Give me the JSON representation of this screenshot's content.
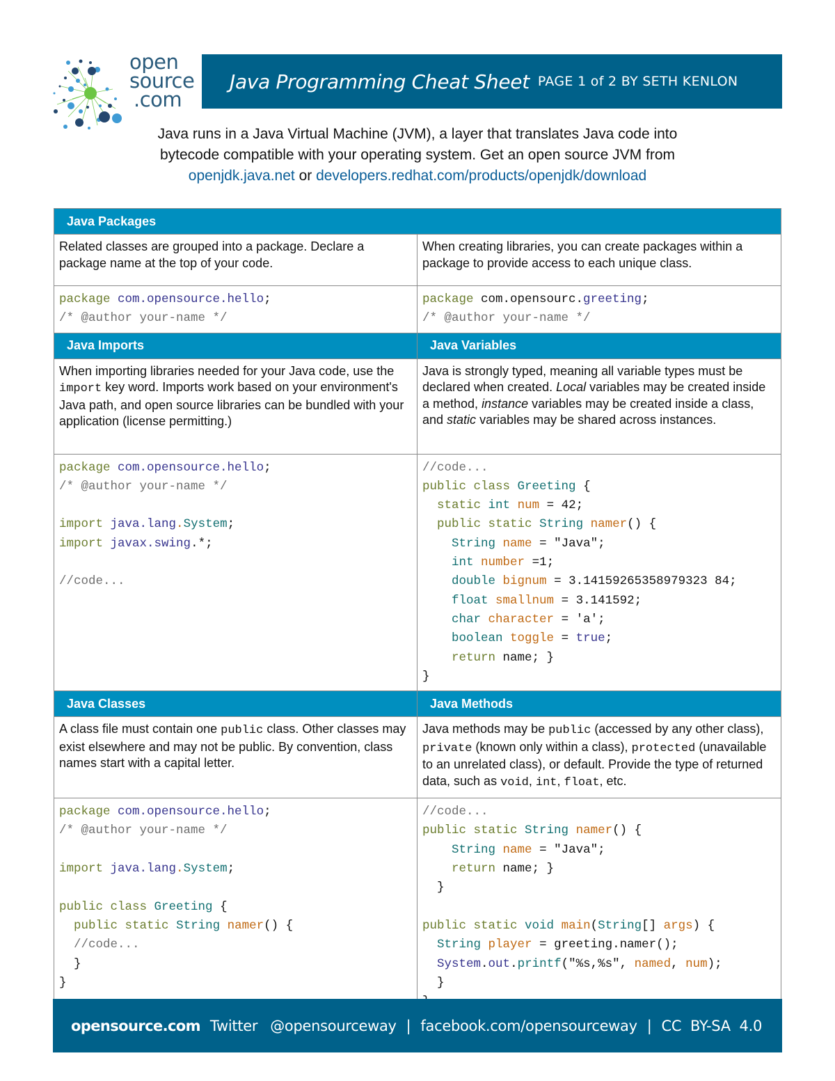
{
  "logo": {
    "line1": "open",
    "line2": "source",
    "line3": ".com",
    "colors": {
      "dark_blue": "#2a5b7c",
      "light_blue": "#3f9bd5",
      "green": "#6cc644"
    }
  },
  "header": {
    "title": "Java Programming Cheat Sheet",
    "subtitle": "PAGE 1 of 2 BY SETH KENLON",
    "bg_color": "#00618a"
  },
  "intro": {
    "line1": "Java runs in a Java Virtual Machine (JVM), a layer that translates Java code into",
    "line2": "bytecode compatible with your operating system. Get an open source JVM from",
    "link1": "openjdk.java.net",
    "or": " or ",
    "link2": "developers.redhat.com/products/openjdk/download"
  },
  "sections": {
    "packages": {
      "title": "Java Packages",
      "left_desc": "Related classes are grouped into a package. Declare a package name at the top of your code.",
      "right_desc": "When creating libraries, you can create packages within a package to provide access to each unique class.",
      "left_code": [
        [
          [
            "kw",
            "package"
          ],
          [
            "pl",
            " "
          ],
          [
            "id",
            "com.opensource.hello"
          ],
          [
            "pl",
            ";"
          ]
        ],
        [
          [
            "cm",
            "/* @author your-name */"
          ]
        ]
      ],
      "right_code": [
        [
          [
            "kw",
            "package"
          ],
          [
            "pl",
            " com.opensourc."
          ],
          [
            "id",
            "greeting"
          ],
          [
            "pl",
            ";"
          ]
        ],
        [
          [
            "cm",
            "/* @author your-name */"
          ]
        ]
      ]
    },
    "imports": {
      "title": "Java Imports",
      "desc_parts": [
        "When importing libraries needed for your Java code, use the ",
        "import",
        " key word. Imports work based on your environment's Java path, and open source libraries can be bundled with your application (license permitting.)"
      ],
      "code": [
        [
          [
            "kw",
            "package"
          ],
          [
            "pl",
            " "
          ],
          [
            "id",
            "com.opensource.hello"
          ],
          [
            "pl",
            ";"
          ]
        ],
        [
          [
            "cm",
            "/* @author your-name */"
          ]
        ],
        [],
        [
          [
            "kw",
            "import"
          ],
          [
            "pl",
            " "
          ],
          [
            "id",
            "java.lang"
          ],
          [
            "vr",
            "."
          ],
          [
            "ty",
            "System"
          ],
          [
            "pl",
            ";"
          ]
        ],
        [
          [
            "kw",
            "import"
          ],
          [
            "pl",
            " "
          ],
          [
            "id",
            "javax.swing"
          ],
          [
            "pl",
            ".*;"
          ]
        ],
        [],
        [
          [
            "cm",
            "//code..."
          ]
        ]
      ]
    },
    "variables": {
      "title": "Java Variables",
      "desc_parts": [
        "Java is strongly typed, meaning all variable types must be declared when created. ",
        "Local",
        " variables may be created inside a method, ",
        "instance",
        " variables may be created inside a class, and ",
        "static",
        " variables may be shared across instances."
      ],
      "code": [
        [
          [
            "cm",
            "//code..."
          ]
        ],
        [
          [
            "kw",
            "public class"
          ],
          [
            "pl",
            " "
          ],
          [
            "ty",
            "Greeting"
          ],
          [
            "pl",
            " {"
          ]
        ],
        [
          [
            "pl",
            "  "
          ],
          [
            "kw",
            "static"
          ],
          [
            "pl",
            " "
          ],
          [
            "ty",
            "int"
          ],
          [
            "pl",
            " "
          ],
          [
            "vr",
            "num"
          ],
          [
            "pl",
            " = 42;"
          ]
        ],
        [
          [
            "pl",
            "  "
          ],
          [
            "kw",
            "public static"
          ],
          [
            "pl",
            " "
          ],
          [
            "ty",
            "String"
          ],
          [
            "pl",
            " "
          ],
          [
            "vr",
            "namer"
          ],
          [
            "pl",
            "() {"
          ]
        ],
        [
          [
            "pl",
            "    "
          ],
          [
            "ty",
            "String"
          ],
          [
            "pl",
            " "
          ],
          [
            "vr",
            "name"
          ],
          [
            "pl",
            " = \"Java\";"
          ]
        ],
        [
          [
            "pl",
            "    "
          ],
          [
            "ty",
            "int"
          ],
          [
            "pl",
            " "
          ],
          [
            "vr",
            "number"
          ],
          [
            "pl",
            " =1;"
          ]
        ],
        [
          [
            "pl",
            "    "
          ],
          [
            "ty",
            "double"
          ],
          [
            "pl",
            " "
          ],
          [
            "vr",
            "bignum"
          ],
          [
            "pl",
            " = 3.14159265358979323 84;"
          ]
        ],
        [
          [
            "pl",
            "    "
          ],
          [
            "ty",
            "float"
          ],
          [
            "pl",
            " "
          ],
          [
            "vr",
            "smallnum"
          ],
          [
            "pl",
            " = 3.141592;"
          ]
        ],
        [
          [
            "pl",
            "    "
          ],
          [
            "ty",
            "char"
          ],
          [
            "pl",
            " "
          ],
          [
            "vr",
            "character"
          ],
          [
            "pl",
            " = 'a';"
          ]
        ],
        [
          [
            "pl",
            "    "
          ],
          [
            "ty",
            "boolean"
          ],
          [
            "pl",
            " "
          ],
          [
            "vr",
            "toggle"
          ],
          [
            "pl",
            " = "
          ],
          [
            "id",
            "true"
          ],
          [
            "pl",
            ";"
          ]
        ],
        [
          [
            "pl",
            "    "
          ],
          [
            "kw",
            "return"
          ],
          [
            "pl",
            " name; }"
          ]
        ],
        [
          [
            "pl",
            "}"
          ]
        ]
      ]
    },
    "classes": {
      "title": "Java Classes",
      "desc_parts": [
        "A class file must contain one ",
        "public",
        " class. Other classes may exist elsewhere and may not be public. By convention, class names start with a capital letter."
      ],
      "code": [
        [
          [
            "kw",
            "package"
          ],
          [
            "pl",
            " "
          ],
          [
            "id",
            "com.opensource.hello"
          ],
          [
            "pl",
            ";"
          ]
        ],
        [
          [
            "cm",
            "/* @author your-name */"
          ]
        ],
        [],
        [
          [
            "kw",
            "import"
          ],
          [
            "pl",
            " "
          ],
          [
            "id",
            "java.lang"
          ],
          [
            "vr",
            "."
          ],
          [
            "ty",
            "System"
          ],
          [
            "pl",
            ";"
          ]
        ],
        [],
        [
          [
            "kw",
            "public class"
          ],
          [
            "pl",
            " "
          ],
          [
            "ty",
            "Greeting"
          ],
          [
            "pl",
            " {"
          ]
        ],
        [
          [
            "pl",
            "  "
          ],
          [
            "kw",
            "public static"
          ],
          [
            "pl",
            " "
          ],
          [
            "ty",
            "String"
          ],
          [
            "pl",
            " "
          ],
          [
            "vr",
            "namer"
          ],
          [
            "pl",
            "() {"
          ]
        ],
        [
          [
            "pl",
            "  "
          ],
          [
            "cm",
            "//code..."
          ]
        ],
        [
          [
            "pl",
            "  }"
          ]
        ],
        [
          [
            "pl",
            "}"
          ]
        ]
      ]
    },
    "methods": {
      "title": "Java Methods",
      "desc_parts": [
        "Java methods may be ",
        "public",
        " (accessed by any other class), ",
        "private",
        " (known only within a class), ",
        "protected",
        " (unavailable to an unrelated class), or default. Provide the type of returned data, such as ",
        "void",
        ", ",
        "int",
        ", ",
        "float",
        ", etc."
      ],
      "code": [
        [
          [
            "cm",
            "//code..."
          ]
        ],
        [
          [
            "kw",
            "public static"
          ],
          [
            "pl",
            " "
          ],
          [
            "ty",
            "String"
          ],
          [
            "pl",
            " "
          ],
          [
            "vr",
            "namer"
          ],
          [
            "pl",
            "() {"
          ]
        ],
        [
          [
            "pl",
            "    "
          ],
          [
            "ty",
            "String"
          ],
          [
            "pl",
            " "
          ],
          [
            "vr",
            "name"
          ],
          [
            "pl",
            " = \"Java\";"
          ]
        ],
        [
          [
            "pl",
            "    "
          ],
          [
            "kw",
            "return"
          ],
          [
            "pl",
            " name; }"
          ]
        ],
        [
          [
            "pl",
            "  }"
          ]
        ],
        [],
        [
          [
            "kw",
            "public static"
          ],
          [
            "pl",
            " "
          ],
          [
            "ty",
            "void"
          ],
          [
            "pl",
            " "
          ],
          [
            "vr",
            "main"
          ],
          [
            "pl",
            "("
          ],
          [
            "ty",
            "String"
          ],
          [
            "pl",
            "[] "
          ],
          [
            "vr",
            "args"
          ],
          [
            "pl",
            ") {"
          ]
        ],
        [
          [
            "pl",
            "  "
          ],
          [
            "ty",
            "String"
          ],
          [
            "pl",
            " "
          ],
          [
            "vr",
            "player"
          ],
          [
            "pl",
            " = greeting.namer();"
          ]
        ],
        [
          [
            "pl",
            "  "
          ],
          [
            "id",
            "System"
          ],
          [
            "pl",
            "."
          ],
          [
            "id",
            "out"
          ],
          [
            "pl",
            "."
          ],
          [
            "ty",
            "printf"
          ],
          [
            "pl",
            "(\"%s,%s\", "
          ],
          [
            "vr",
            "named"
          ],
          [
            "pl",
            ", "
          ],
          [
            "vr",
            "num"
          ],
          [
            "pl",
            ");"
          ]
        ],
        [
          [
            "pl",
            "  }"
          ]
        ],
        [
          [
            "pl",
            "}"
          ]
        ]
      ]
    }
  },
  "footer": {
    "brand": "opensource.com",
    "twitter_label": "Twitter",
    "twitter_handle": "@opensourceway",
    "separator": "|",
    "facebook": "facebook.com/opensourceway",
    "license": "CC  BY-SA  4.0"
  },
  "colors": {
    "section_header": "#008fbf",
    "keyword": "#6b7d2e",
    "type": "#137072",
    "identifier": "#37348e",
    "variable": "#c06a14",
    "comment": "#6e6e6e",
    "link": "#0a5e98"
  }
}
